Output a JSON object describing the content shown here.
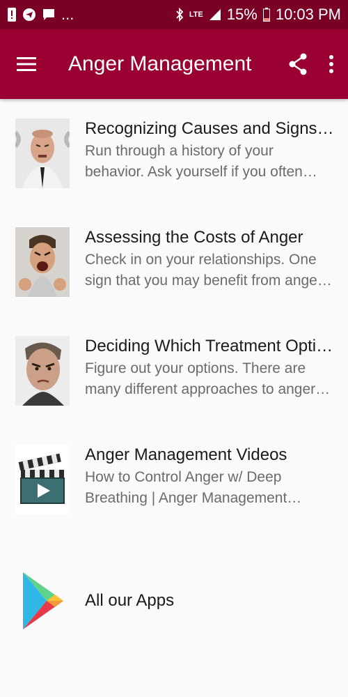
{
  "statusbar": {
    "notif_more": "...",
    "network": "LTE",
    "battery": "15%",
    "time": "10:03 PM"
  },
  "appbar": {
    "title": "Anger Management",
    "menu_icon": "hamburger-menu-icon",
    "share_icon": "share-icon",
    "overflow_icon": "more-vert-icon"
  },
  "items": [
    {
      "title": "Recognizing Causes and Signs of …",
      "description": "Run through a history of your behavior. Ask yourself if you often react violently …"
    },
    {
      "title": "Assessing the Costs of Anger",
      "description": "Check in on your relationships. One sign that you may benefit from anger m…"
    },
    {
      "title": "Deciding Which Treatment Option …",
      "description": "Figure out your options. There are many different approaches to anger ma…"
    },
    {
      "title": "Anger Management Videos",
      "description": "How to Control Anger w/ Deep Breathing | Anger Management…"
    }
  ],
  "apps": {
    "label": "All our Apps"
  },
  "colors": {
    "statusbar": "#7a0026",
    "appbar": "#9b0033",
    "background": "#fafafa",
    "description_text": "#6b6b6b"
  }
}
